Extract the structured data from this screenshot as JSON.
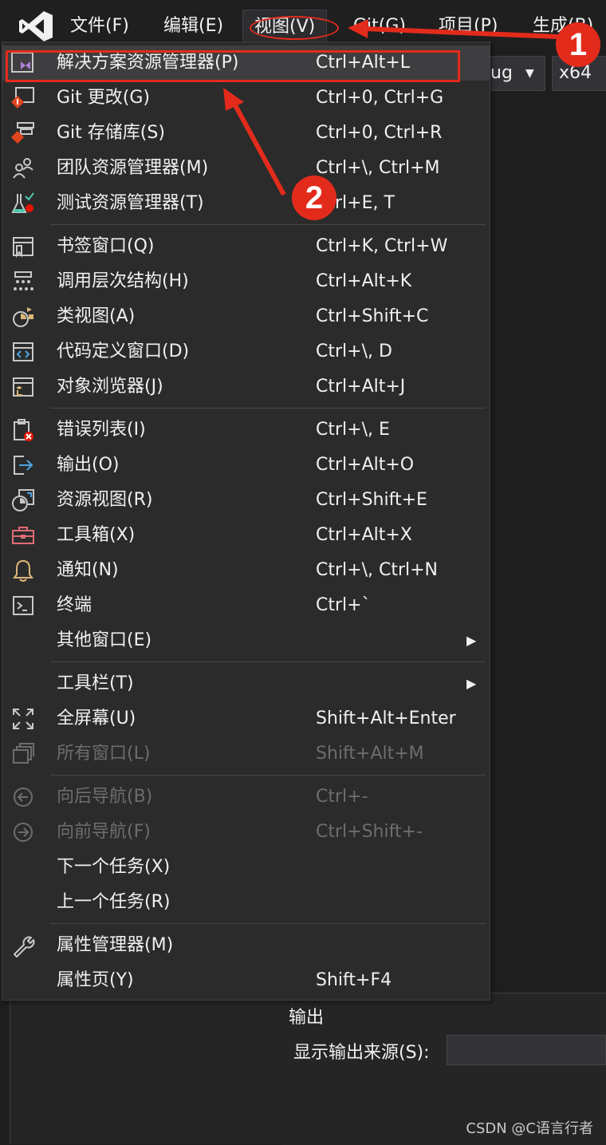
{
  "menubar": {
    "items": [
      {
        "label": "文件(F)"
      },
      {
        "label": "编辑(E)"
      },
      {
        "label": "视图(V)"
      },
      {
        "label": "Git(G)"
      },
      {
        "label": "项目(P)"
      },
      {
        "label": "生成(B)"
      }
    ]
  },
  "toolbar": {
    "config_value": "ug",
    "platform_value": "x64"
  },
  "view_menu": {
    "items": [
      {
        "label": "解决方案资源管理器(P)",
        "shortcut": "Ctrl+Alt+L",
        "icon": "solution-explorer-icon"
      },
      {
        "label": "Git 更改(G)",
        "shortcut": "Ctrl+0, Ctrl+G",
        "icon": "git-changes-icon"
      },
      {
        "label": "Git 存储库(S)",
        "shortcut": "Ctrl+0, Ctrl+R",
        "icon": "git-repository-icon"
      },
      {
        "label": "团队资源管理器(M)",
        "shortcut": "Ctrl+\\, Ctrl+M",
        "icon": "team-explorer-icon"
      },
      {
        "label": "测试资源管理器(T)",
        "shortcut": "Ctrl+E, T",
        "icon": "test-explorer-icon"
      },
      {
        "label": "书签窗口(Q)",
        "shortcut": "Ctrl+K, Ctrl+W",
        "icon": "bookmark-window-icon"
      },
      {
        "label": "调用层次结构(H)",
        "shortcut": "Ctrl+Alt+K",
        "icon": "call-hierarchy-icon"
      },
      {
        "label": "类视图(A)",
        "shortcut": "Ctrl+Shift+C",
        "icon": "class-view-icon"
      },
      {
        "label": "代码定义窗口(D)",
        "shortcut": "Ctrl+\\, D",
        "icon": "code-definition-icon"
      },
      {
        "label": "对象浏览器(J)",
        "shortcut": "Ctrl+Alt+J",
        "icon": "object-browser-icon"
      },
      {
        "label": "错误列表(I)",
        "shortcut": "Ctrl+\\, E",
        "icon": "error-list-icon"
      },
      {
        "label": "输出(O)",
        "shortcut": "Ctrl+Alt+O",
        "icon": "output-icon"
      },
      {
        "label": "资源视图(R)",
        "shortcut": "Ctrl+Shift+E",
        "icon": "resource-view-icon"
      },
      {
        "label": "工具箱(X)",
        "shortcut": "Ctrl+Alt+X",
        "icon": "toolbox-icon"
      },
      {
        "label": "通知(N)",
        "shortcut": "Ctrl+\\, Ctrl+N",
        "icon": "bell-icon"
      },
      {
        "label": "终端",
        "shortcut": "Ctrl+`",
        "icon": "terminal-icon"
      },
      {
        "label": "其他窗口(E)",
        "shortcut": "",
        "icon": ""
      },
      {
        "label": "工具栏(T)",
        "shortcut": "",
        "icon": ""
      },
      {
        "label": "全屏幕(U)",
        "shortcut": "Shift+Alt+Enter",
        "icon": "fullscreen-icon"
      },
      {
        "label": "所有窗口(L)",
        "shortcut": "Shift+Alt+M",
        "icon": "all-windows-icon"
      },
      {
        "label": "向后导航(B)",
        "shortcut": "Ctrl+-",
        "icon": "navigate-back-icon"
      },
      {
        "label": "向前导航(F)",
        "shortcut": "Ctrl+Shift+-",
        "icon": "navigate-forward-icon"
      },
      {
        "label": "下一个任务(X)",
        "shortcut": "",
        "icon": ""
      },
      {
        "label": "上一个任务(R)",
        "shortcut": "",
        "icon": ""
      },
      {
        "label": "属性管理器(M)",
        "shortcut": "",
        "icon": "wrench-icon"
      },
      {
        "label": "属性页(Y)",
        "shortcut": "Shift+F4",
        "icon": ""
      }
    ]
  },
  "annotations": {
    "badge1": "1",
    "badge2": "2",
    "accent_color": "#e32b1c"
  },
  "output_panel": {
    "title": "输出",
    "source_label": "显示输出来源(S):"
  },
  "watermark": "CSDN @C语言行者"
}
